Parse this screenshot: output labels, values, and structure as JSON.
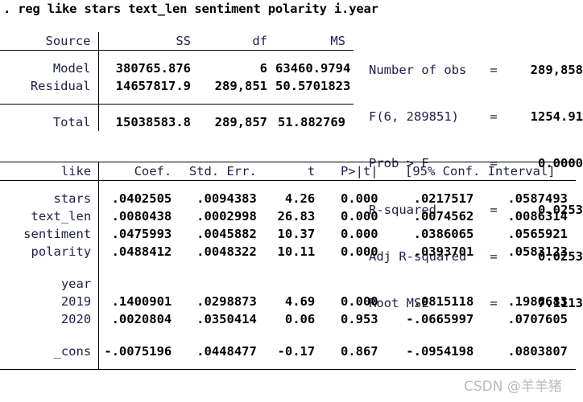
{
  "command": {
    "prompt": ". ",
    "text": "reg like stars text_len sentiment polarity i.year",
    "full": ". reg like stars text_len sentiment polarity i.year"
  },
  "anova": {
    "headers": [
      "Source",
      "SS",
      "df",
      "MS"
    ],
    "rows": [
      {
        "source": "Model",
        "ss": "380765.876",
        "df": "6",
        "ms": "63460.9794"
      },
      {
        "source": "Residual",
        "ss": "14657817.9",
        "df": "289,851",
        "ms": "50.5701823"
      },
      {
        "source": "Total",
        "ss": "15038583.8",
        "df": "289,857",
        "ms": "51.882769"
      }
    ]
  },
  "model_stats": [
    {
      "label": "Number of obs",
      "eq": "=",
      "value": "289,858"
    },
    {
      "label": "F(6, 289851)",
      "eq": "=",
      "value": "1254.91"
    },
    {
      "label": "Prob > F",
      "eq": "=",
      "value": "0.0000"
    },
    {
      "label": "R-squared",
      "eq": "=",
      "value": "0.0253"
    },
    {
      "label": "Adj R-squared",
      "eq": "=",
      "value": "0.0253"
    },
    {
      "label": "Root MSE",
      "eq": "=",
      "value": "7.1113"
    }
  ],
  "coef_table": {
    "depvar": "like",
    "headers": {
      "coef": "Coef.",
      "std_err": "Std. Err.",
      "t": "t",
      "p": "P>|t|",
      "ci": "[95% Conf. Interval]"
    },
    "rows": [
      {
        "name": "stars",
        "coef": ".0402505",
        "std_err": ".0094383",
        "t": "4.26",
        "p": "0.000",
        "ci_low": ".0217517",
        "ci_high": ".0587493"
      },
      {
        "name": "text_len",
        "coef": ".0080438",
        "std_err": ".0002998",
        "t": "26.83",
        "p": "0.000",
        "ci_low": ".0074562",
        "ci_high": ".0086314"
      },
      {
        "name": "sentiment",
        "coef": ".0475993",
        "std_err": ".0045882",
        "t": "10.37",
        "p": "0.000",
        "ci_low": ".0386065",
        "ci_high": ".0565921"
      },
      {
        "name": "polarity",
        "coef": ".0488412",
        "std_err": ".0048322",
        "t": "10.11",
        "p": "0.000",
        "ci_low": ".0393701",
        "ci_high": ".0583123"
      }
    ],
    "group_label": "year",
    "group_rows": [
      {
        "name": "2019",
        "coef": ".1400901",
        "std_err": ".0298873",
        "t": "4.69",
        "p": "0.000",
        "ci_low": ".0815118",
        "ci_high": ".1986683"
      },
      {
        "name": "2020",
        "coef": ".0020804",
        "std_err": ".0350414",
        "t": "0.06",
        "p": "0.953",
        "ci_low": "-.0665997",
        "ci_high": ".0707605"
      }
    ],
    "constant": {
      "name": "_cons",
      "coef": "-.0075196",
      "std_err": ".0448477",
      "t": "-0.17",
      "p": "0.867",
      "ci_low": "-.0954198",
      "ci_high": ".0803807"
    }
  },
  "watermark": {
    "text": "CSDN @羊羊猪"
  },
  "colors": {
    "background": "#ffffff",
    "label_text": "#20204a",
    "value_text": "#000000",
    "rule": "#000000",
    "watermark": "#828282"
  }
}
